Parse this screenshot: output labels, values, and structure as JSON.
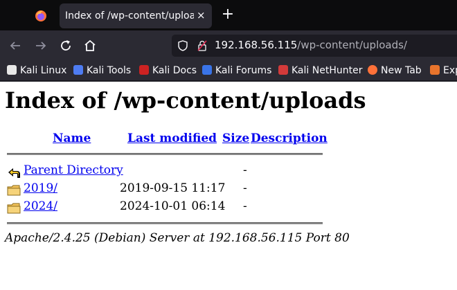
{
  "browser": {
    "tab": {
      "title": "Index of /wp-content/uploads/",
      "close_glyph": "×"
    },
    "new_tab_glyph": "+",
    "url": {
      "host": "192.168.56.115",
      "path": "/wp-content/uploads/"
    },
    "bookmarks": [
      {
        "label": "Kali Linux",
        "icon": "kali-dragon-icon",
        "color": "#e8e8e8"
      },
      {
        "label": "Kali Tools",
        "icon": "kali-tools-icon",
        "color": "#4e7cf2"
      },
      {
        "label": "Kali Docs",
        "icon": "kali-docs-icon",
        "color": "#cc2222"
      },
      {
        "label": "Kali Forums",
        "icon": "kali-forums-icon",
        "color": "#3a74e8"
      },
      {
        "label": "Kali NetHunter",
        "icon": "nethunter-icon",
        "color": "#d33a3a"
      },
      {
        "label": "New Tab",
        "icon": "firefox-icon",
        "color": "#ff7139"
      },
      {
        "label": "Exp",
        "icon": "exploit-db-icon",
        "color": "#e8742c"
      }
    ]
  },
  "page": {
    "title": "Index of /wp-content/uploads",
    "columns": {
      "name": "Name",
      "last_modified": "Last modified",
      "size": "Size",
      "description": "Description"
    },
    "rows": [
      {
        "name": "Parent Directory",
        "modified": "",
        "size": "-",
        "icon": "back-arrow-icon"
      },
      {
        "name": "2019/",
        "modified": "2019-09-15 11:17",
        "size": "-",
        "icon": "folder-icon"
      },
      {
        "name": "2024/",
        "modified": "2024-10-01 06:14",
        "size": "-",
        "icon": "folder-icon"
      }
    ],
    "server_signature": "Apache/2.4.25 (Debian) Server at 192.168.56.115 Port 80"
  }
}
